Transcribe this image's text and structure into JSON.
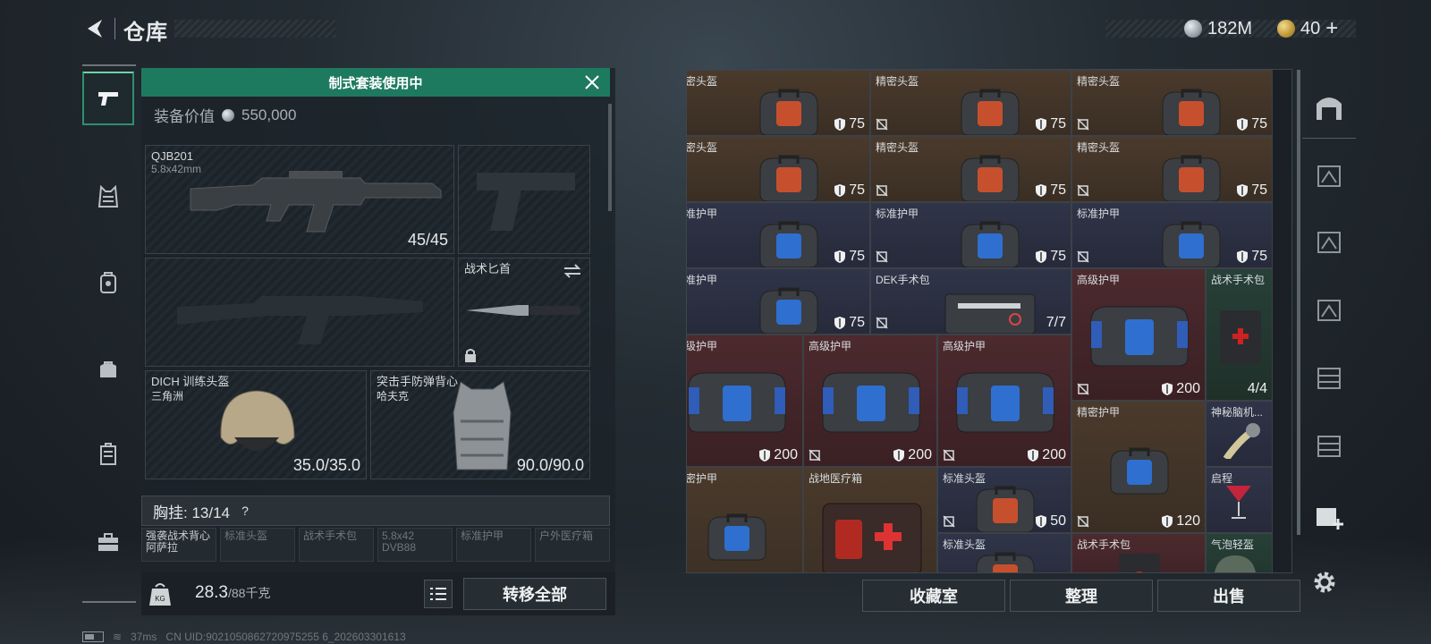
{
  "header": {
    "title": "仓库",
    "currency_main": "182M",
    "currency_premium": "40",
    "add_label": "+"
  },
  "sidebar": {
    "items": [
      {
        "name": "weapons",
        "icon": "pistol-icon",
        "active": true
      },
      {
        "name": "chest-rig",
        "icon": "vest-icon",
        "active": false
      },
      {
        "name": "backpack",
        "icon": "backpack-icon",
        "active": false
      },
      {
        "name": "bag",
        "icon": "bag-icon",
        "active": false
      },
      {
        "name": "case",
        "icon": "case-icon",
        "active": false
      },
      {
        "name": "toolbox",
        "icon": "toolbox-icon",
        "active": false
      }
    ]
  },
  "loadout": {
    "banner": "制式套装使用中",
    "equip_value_label": "装备价值",
    "equip_value": "550,000",
    "primary": {
      "name": "QJB201",
      "caliber": "5.8x42mm",
      "ammo": "45/45"
    },
    "melee": {
      "name": "战术匕首"
    },
    "helmet": {
      "name": "DICH 训练头盔",
      "sub": "三角洲",
      "durability": "35.0/35.0"
    },
    "armor": {
      "name": "突击手防弹背心",
      "sub": "哈夫克",
      "durability": "90.0/90.0"
    },
    "chest_rig": "胸挂: 13/14",
    "chest_rig_help": "?",
    "mini_items": [
      "强袭战术背心 阿萨拉",
      "标准头盔",
      "战术手术包",
      "5.8x42 DVB88",
      "标准护甲",
      "户外医疗箱"
    ],
    "weight": "28.3",
    "weight_max": "/88千克",
    "weight_icon_label": "KG",
    "transfer_all": "转移全部"
  },
  "storage": {
    "cells": [
      {
        "label": "精密头盔",
        "value": "75",
        "color": "brown",
        "kind": "bag-red"
      },
      {
        "label": "精密头盔",
        "value": "75",
        "color": "brown",
        "kind": "bag-red"
      },
      {
        "label": "精密头盔",
        "value": "75",
        "color": "brown",
        "kind": "bag-red"
      },
      {
        "label": "精密头盔",
        "value": "75",
        "color": "brown",
        "kind": "bag-red"
      },
      {
        "label": "精密头盔",
        "value": "75",
        "color": "brown",
        "kind": "bag-red"
      },
      {
        "label": "精密头盔",
        "value": "75",
        "color": "brown",
        "kind": "bag-red"
      },
      {
        "label": "标准护甲",
        "value": "75",
        "color": "navy",
        "kind": "bag-blue"
      },
      {
        "label": "标准护甲",
        "value": "75",
        "color": "navy",
        "kind": "bag-blue"
      },
      {
        "label": "标准护甲",
        "value": "75",
        "color": "navy",
        "kind": "bag-blue"
      },
      {
        "label": "标准护甲",
        "value": "75",
        "color": "navy",
        "kind": "bag-blue"
      },
      {
        "label": "DEK手术包",
        "value": "7/7",
        "color": "navy",
        "kind": "kit"
      },
      {
        "label": "高级护甲",
        "value": "200",
        "color": "red",
        "kind": "bag-big"
      },
      {
        "label": "战术手术包",
        "value": "4/4",
        "color": "green",
        "kind": "med"
      },
      {
        "label": "高级护甲",
        "value": "200",
        "color": "red",
        "kind": "bag-big"
      },
      {
        "label": "高级护甲",
        "value": "200",
        "color": "red",
        "kind": "bag-big"
      },
      {
        "label": "高级护甲",
        "value": "200",
        "color": "red",
        "kind": "bag-big"
      },
      {
        "label": "精密护甲",
        "value": "120",
        "color": "brown",
        "kind": "bag-blue"
      },
      {
        "label": "神秘脑机...",
        "value": "",
        "color": "navy",
        "kind": "device"
      },
      {
        "label": "精密护甲",
        "value": "",
        "color": "brown",
        "kind": "bag-blue"
      },
      {
        "label": "战地医疗箱",
        "value": "",
        "color": "brown",
        "kind": "firstaid"
      },
      {
        "label": "标准头盔",
        "value": "50",
        "color": "navy",
        "kind": "bag-red"
      },
      {
        "label": "启程",
        "value": "",
        "color": "navy",
        "kind": "glass"
      },
      {
        "label": "标准头盔",
        "value": "",
        "color": "navy",
        "kind": "bag-red"
      },
      {
        "label": "战术手术包",
        "value": "",
        "color": "red",
        "kind": "med"
      },
      {
        "label": "气泡轻盔",
        "value": "",
        "color": "green",
        "kind": "helmet"
      }
    ]
  },
  "store_tabs": [
    "tab-all",
    "tab-1",
    "tab-2",
    "tab-3",
    "tab-4",
    "tab-5",
    "tab-6",
    "tab-add"
  ],
  "buttons": {
    "collection": "收藏室",
    "sort": "整理",
    "sell": "出售"
  },
  "status": {
    "ping": "37ms",
    "uid": "CN UID:9021050862720975255 6_202603301613"
  },
  "colors": {
    "accent_green": "#1e7a5f",
    "brown_cell": "#4a3a2c",
    "navy_cell": "#2f3448",
    "red_cell": "#4c2a2e",
    "green_cell": "#274038"
  }
}
